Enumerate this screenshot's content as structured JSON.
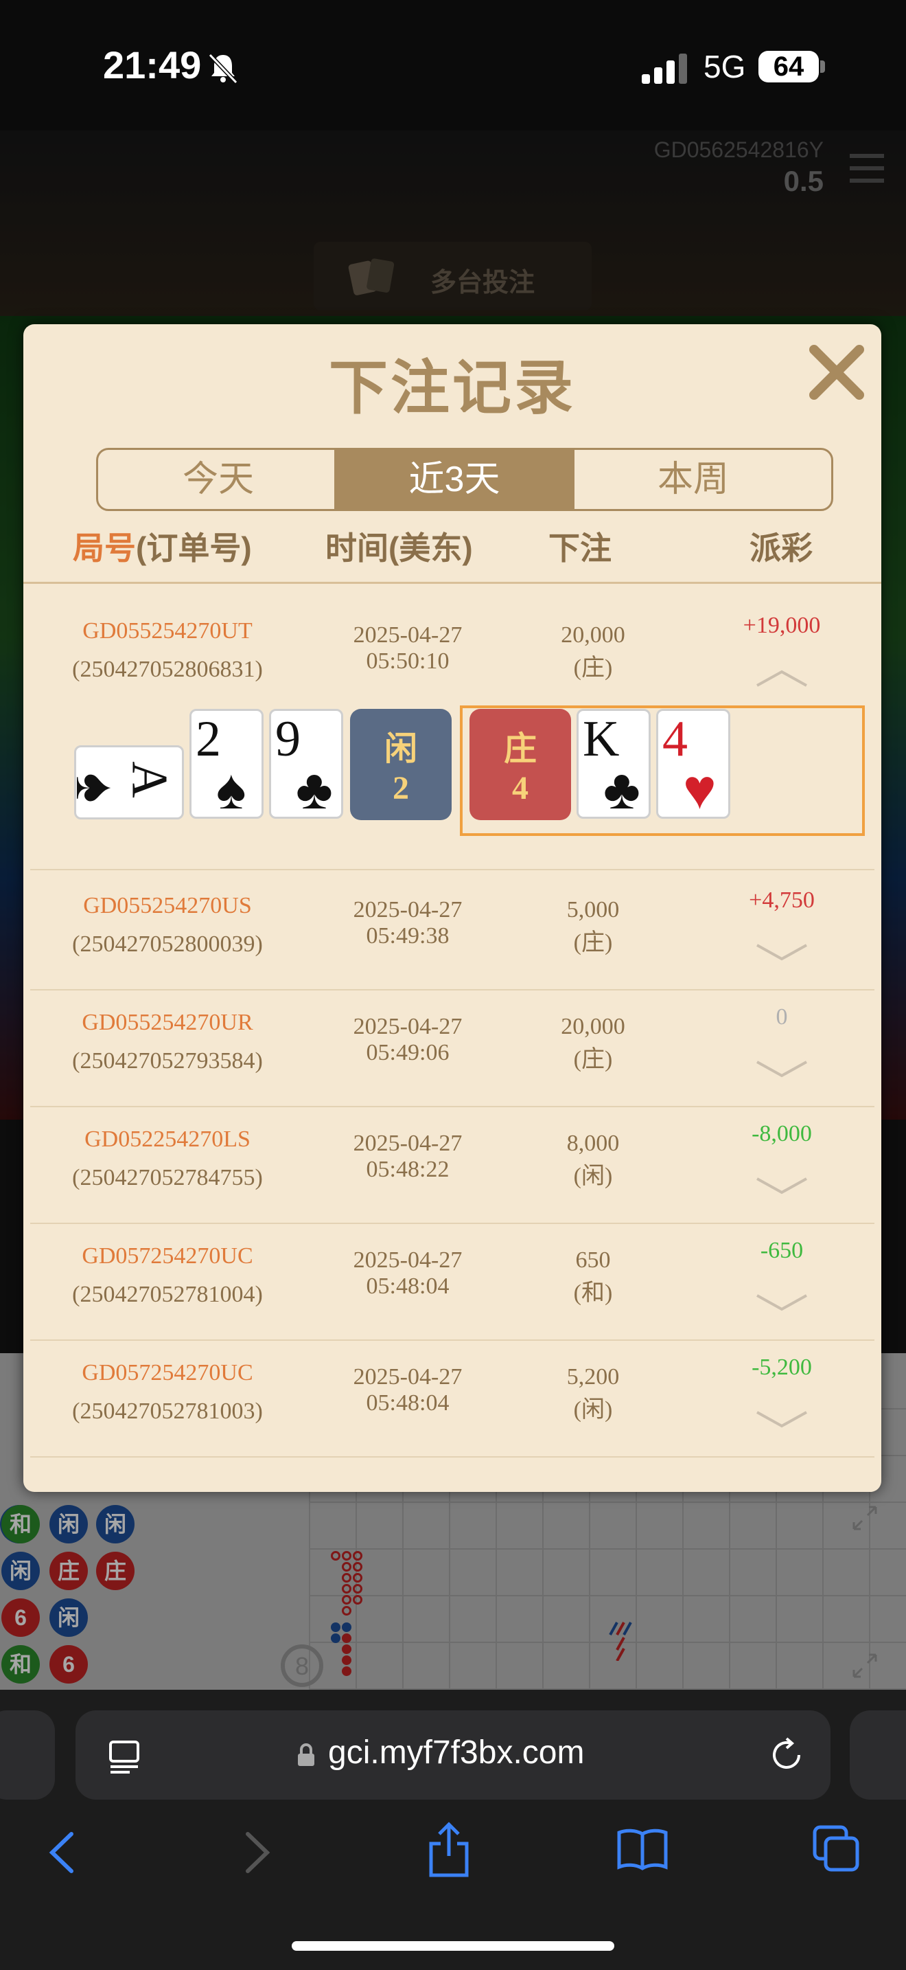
{
  "status_bar": {
    "time": "21:49",
    "network": "5G",
    "battery": "64"
  },
  "game": {
    "account_id": "GD0562542816Y",
    "balance": "0.5",
    "multi_table_bet_label": "多台投注"
  },
  "browser": {
    "url": "gci.myf7f3bx.com"
  },
  "modal": {
    "title": "下注记录",
    "tabs": [
      {
        "label": "今天",
        "active": false
      },
      {
        "label": "近3天",
        "active": true
      },
      {
        "label": "本周",
        "active": false
      }
    ],
    "columns": {
      "round_prefix": "局号",
      "round_suffix": "(订单号)",
      "time": "时间(美东)",
      "bet": "下注",
      "payout": "派彩"
    },
    "records": [
      {
        "round": "GD055254270UT",
        "order": "(250427052806831)",
        "date": "2025-04-27",
        "time": "05:50:10",
        "bet": "20,000",
        "side": "(庄)",
        "payout": "+19,000",
        "payout_type": "pos",
        "expanded": true
      },
      {
        "round": "GD055254270US",
        "order": "(250427052800039)",
        "date": "2025-04-27",
        "time": "05:49:38",
        "bet": "5,000",
        "side": "(庄)",
        "payout": "+4,750",
        "payout_type": "pos",
        "expanded": false
      },
      {
        "round": "GD055254270UR",
        "order": "(250427052793584)",
        "date": "2025-04-27",
        "time": "05:49:06",
        "bet": "20,000",
        "side": "(庄)",
        "payout": "0",
        "payout_type": "zero",
        "expanded": false
      },
      {
        "round": "GD052254270LS",
        "order": "(250427052784755)",
        "date": "2025-04-27",
        "time": "05:48:22",
        "bet": "8,000",
        "side": "(闲)",
        "payout": "-8,000",
        "payout_type": "neg",
        "expanded": false
      },
      {
        "round": "GD057254270UC",
        "order": "(250427052781004)",
        "date": "2025-04-27",
        "time": "05:48:04",
        "bet": "650",
        "side": "(和)",
        "payout": "-650",
        "payout_type": "neg",
        "expanded": false
      },
      {
        "round": "GD057254270UC",
        "order": "(250427052781003)",
        "date": "2025-04-27",
        "time": "05:48:04",
        "bet": "5,200",
        "side": "(闲)",
        "payout": "-5,200",
        "payout_type": "neg",
        "expanded": false
      }
    ],
    "detail": {
      "player": {
        "label": "闲",
        "score": "2",
        "cards": [
          {
            "rank": "A",
            "suit": "♠",
            "color": "blk"
          },
          {
            "rank": "2",
            "suit": "♠",
            "color": "blk"
          },
          {
            "rank": "9",
            "suit": "♣",
            "color": "blk"
          }
        ]
      },
      "banker": {
        "label": "庄",
        "score": "4",
        "cards": [
          {
            "rank": "K",
            "suit": "♣",
            "color": "blk"
          },
          {
            "rank": "4",
            "suit": "♥",
            "color": "red"
          }
        ]
      }
    }
  },
  "road_beads": [
    "闲",
    "闲",
    "和",
    "闲",
    "闲",
    "闲",
    "庄",
    "庄",
    "6",
    "闲",
    "和",
    "6"
  ]
}
